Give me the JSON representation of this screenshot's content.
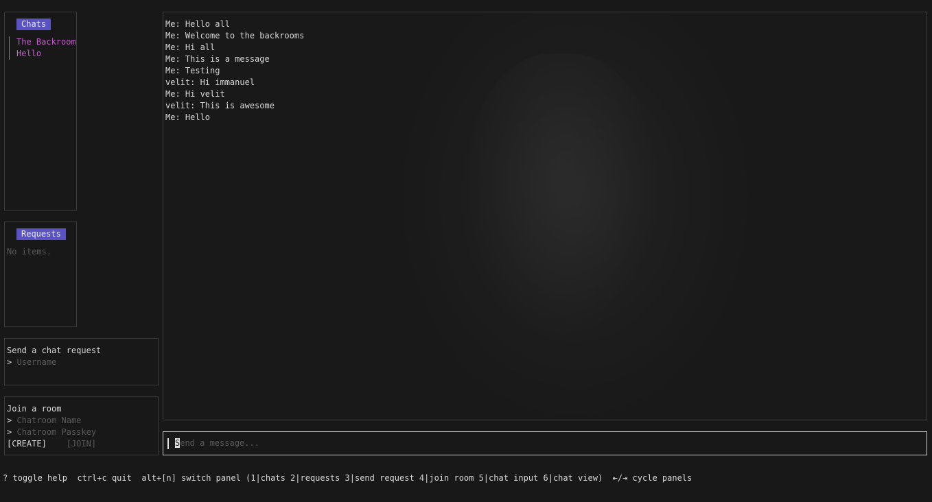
{
  "chats_panel": {
    "title": "Chats",
    "items": [
      "The Backroom",
      "Hello"
    ]
  },
  "requests_panel": {
    "title": "Requests",
    "empty_text": "No items."
  },
  "send_request": {
    "title": "Send a chat request",
    "prompt": ">",
    "placeholder": "Username"
  },
  "join_room": {
    "title": "Join a room",
    "prompt": ">",
    "name_placeholder": "Chatroom Name",
    "passkey_placeholder": "Chatroom Passkey",
    "create_label": "[CREATE]",
    "join_label": "[JOIN]"
  },
  "messages": [
    "Me: Hello all",
    "Me: Welcome to the backrooms",
    "Me: Hi all",
    "Me: This is a message",
    "Me: Testing",
    "velit: Hi immanuel",
    "Me: Hi velit",
    "velit: This is awesome",
    "Me: Hello"
  ],
  "chat_input": {
    "cursor_char": "S",
    "placeholder_rest": "end a message..."
  },
  "footer": {
    "help": "? toggle help",
    "quit": "ctrl+c quit",
    "switch": "alt+[n] switch panel (1|chats 2|requests 3|send request 4|join room 5|chat input 6|chat view)",
    "cycle": "⇤/⇥ cycle panels"
  },
  "colors": {
    "background": "#181818",
    "accent": "#5a52c4",
    "chat_item": "#c060c8",
    "border": "#3c3c3c"
  }
}
